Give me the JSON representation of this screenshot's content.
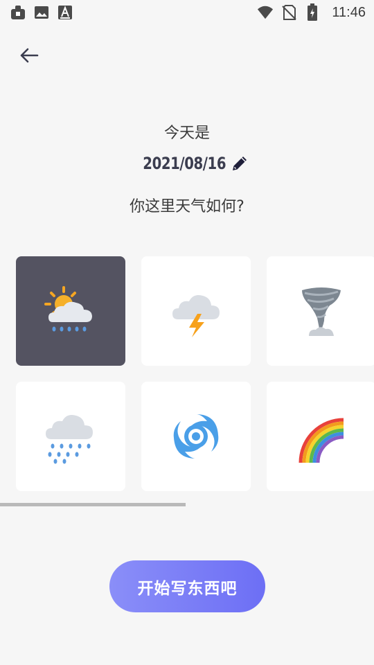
{
  "status_bar": {
    "time": "11:46",
    "left_icons": [
      "app-icon",
      "image-icon",
      "text-a-icon"
    ],
    "right_icons": [
      "wifi-icon",
      "no-sim-icon",
      "battery-charging-icon"
    ]
  },
  "header": {
    "back_icon": "arrow-left-icon"
  },
  "main": {
    "heading": "今天是",
    "date": "2021/08/16",
    "question": "你这里天气如何?"
  },
  "weather_options": [
    {
      "name": "sun-behind-rain-cloud",
      "selected": true
    },
    {
      "name": "cloud-with-lightning",
      "selected": false
    },
    {
      "name": "tornado",
      "selected": false
    },
    {
      "name": "cloud-with-rain",
      "selected": false
    },
    {
      "name": "cyclone",
      "selected": false
    },
    {
      "name": "rainbow",
      "selected": false
    }
  ],
  "scroll": {
    "position_fraction": 0.0,
    "visible_fraction": 0.5
  },
  "cta": {
    "label": "开始写东西吧"
  },
  "colors": {
    "background": "#f6f6f6",
    "selected_tile": "#545361",
    "tile": "#ffffff",
    "cta_start": "#8a8ef8",
    "cta_end": "#6d6ff5",
    "date_text": "#3b3d4f"
  }
}
